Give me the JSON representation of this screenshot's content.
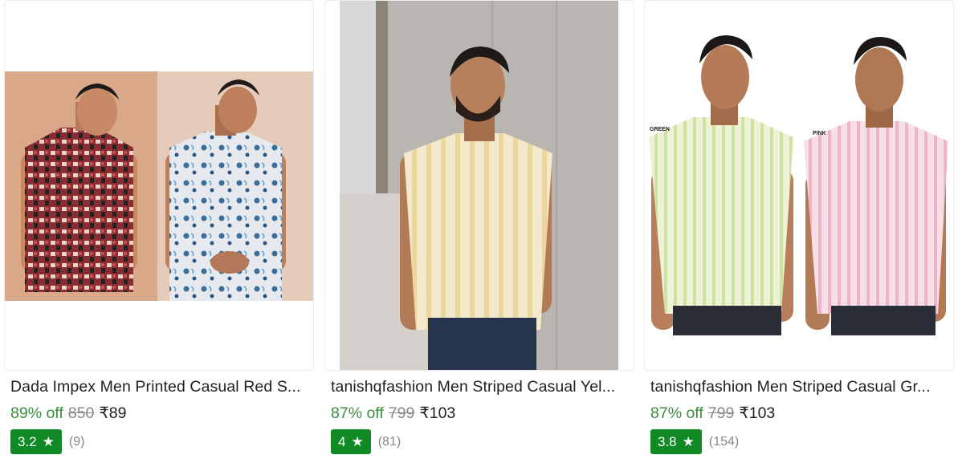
{
  "products": [
    {
      "title": "Dada Impex Men Printed Casual Red S...",
      "discount": "89% off",
      "mrp": "850",
      "price": "₹89",
      "rating": "3.2",
      "reviews": "(9)",
      "star_icon": "star-icon"
    },
    {
      "title": "tanishqfashion Men Striped Casual Yel...",
      "discount": "87% off",
      "mrp": "799",
      "price": "₹103",
      "rating": "4",
      "reviews": "(81)",
      "star_icon": "star-icon"
    },
    {
      "title": "tanishqfashion Men Striped Casual Gr...",
      "discount": "87% off",
      "mrp": "799",
      "price": "₹103",
      "rating": "3.8",
      "reviews": "(154)",
      "star_icon": "star-icon",
      "image_labels": [
        "GREEN",
        "PINK"
      ]
    }
  ],
  "colors": {
    "discount_green": "#388e3c",
    "rating_badge": "#0f8a24",
    "title_text": "#212121",
    "muted_text": "#878787"
  }
}
